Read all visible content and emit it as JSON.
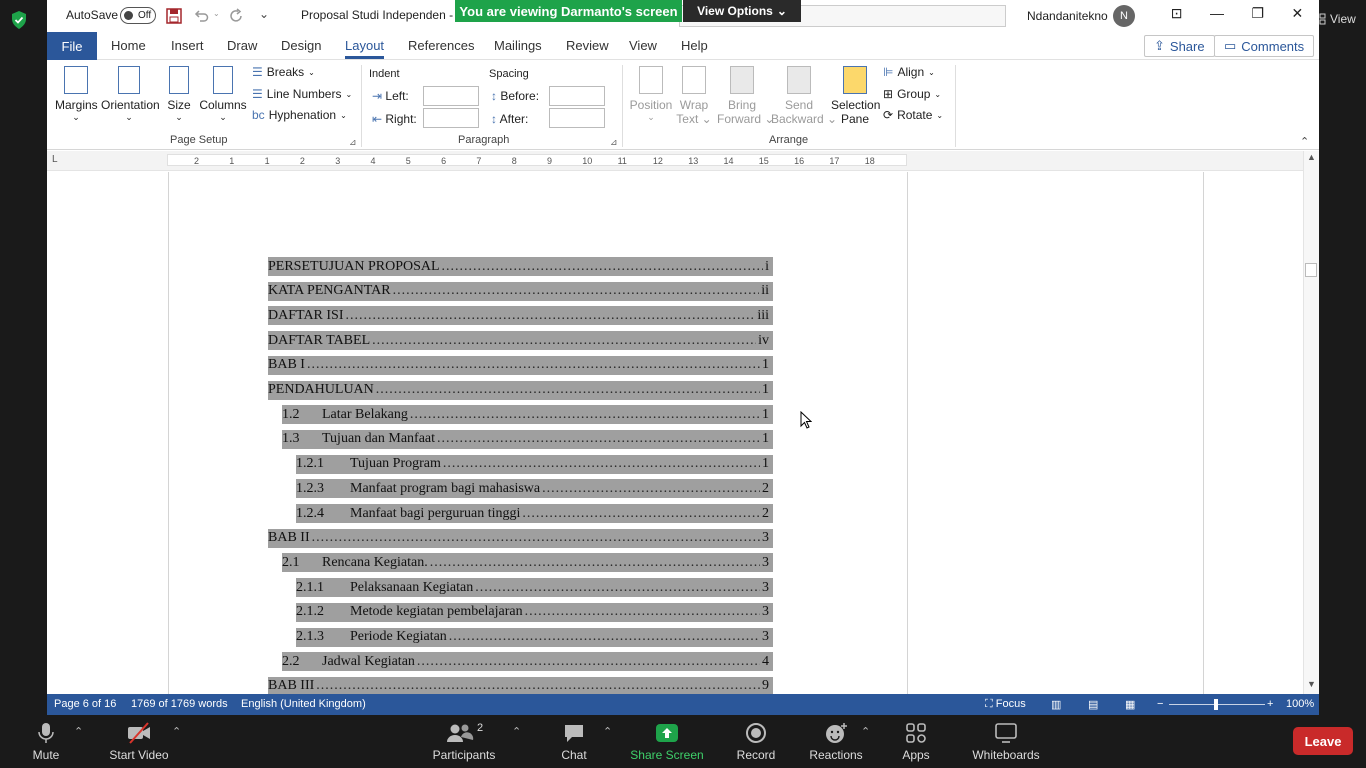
{
  "zoom": {
    "view_label": "View",
    "banner": "You are viewing Darmanto's screen",
    "view_options": "View Options",
    "bottom": {
      "mute": "Mute",
      "start_video": "Start Video",
      "participants": "Participants",
      "participants_count": "2",
      "chat": "Chat",
      "share_screen": "Share Screen",
      "record": "Record",
      "reactions": "Reactions",
      "apps": "Apps",
      "whiteboards": "Whiteboards",
      "leave": "Leave"
    },
    "colors": {
      "share": "#1ea34a",
      "leave": "#c92a2a",
      "bar": "#1a1a1a"
    }
  },
  "word": {
    "titlebar": {
      "autosave": "AutoSave",
      "autosave_state": "Off",
      "doc_title": "Proposal Studi Independen - C",
      "user": "Ndandanitekno",
      "avatar": "N"
    },
    "tabs": [
      "File",
      "Home",
      "Insert",
      "Draw",
      "Design",
      "Layout",
      "References",
      "Mailings",
      "Review",
      "View",
      "Help"
    ],
    "active_tab": "Layout",
    "share": "Share",
    "comments": "Comments",
    "ribbon": {
      "page_setup": {
        "margins": "Margins",
        "orientation": "Orientation",
        "size": "Size",
        "columns": "Columns",
        "breaks": "Breaks",
        "line_numbers": "Line Numbers",
        "hyphenation": "Hyphenation",
        "group": "Page Setup"
      },
      "paragraph": {
        "indent": "Indent",
        "spacing": "Spacing",
        "left": "Left:",
        "right": "Right:",
        "before": "Before:",
        "after": "After:",
        "group": "Paragraph"
      },
      "arrange": {
        "position": "Position",
        "wrap": "Wrap",
        "wrap2": "Text",
        "bring": "Bring",
        "bring2": "Forward",
        "send": "Send",
        "send2": "Backward",
        "selection": "Selection",
        "selection2": "Pane",
        "align": "Align",
        "group_btn": "Group",
        "rotate": "Rotate",
        "group": "Arrange"
      }
    },
    "ruler_numbers": [
      "2",
      "1",
      "1",
      "2",
      "3",
      "4",
      "5",
      "6",
      "7",
      "8",
      "9",
      "10",
      "11",
      "12",
      "13",
      "14",
      "15",
      "16",
      "17",
      "18"
    ],
    "toc": [
      {
        "num": "",
        "title": "PERSETUJUAN PROPOSAL",
        "page": "i",
        "level": 0
      },
      {
        "num": "",
        "title": "KATA PENGANTAR",
        "page": "ii",
        "level": 0
      },
      {
        "num": "",
        "title": "DAFTAR ISI",
        "page": "iii",
        "level": 0
      },
      {
        "num": "",
        "title": "DAFTAR TABEL",
        "page": "iv",
        "level": 0
      },
      {
        "num": "",
        "title": "BAB I",
        "page": "1",
        "level": 0
      },
      {
        "num": "",
        "title": "PENDAHULUAN",
        "page": "1",
        "level": 0
      },
      {
        "num": "1.2",
        "title": "Latar Belakang",
        "page": "1",
        "level": 1
      },
      {
        "num": "1.3",
        "title": "Tujuan dan Manfaat",
        "page": "1",
        "level": 1
      },
      {
        "num": "1.2.1",
        "title": "Tujuan Program",
        "page": "1",
        "level": 2
      },
      {
        "num": "1.2.3",
        "title": "Manfaat program bagi mahasiswa",
        "page": "2",
        "level": 2
      },
      {
        "num": "1.2.4",
        "title": "Manfaat bagi perguruan tinggi",
        "page": "2",
        "level": 2
      },
      {
        "num": "",
        "title": "BAB II",
        "page": "3",
        "level": 0
      },
      {
        "num": "2.1",
        "title": "Rencana Kegiatan.",
        "page": "3",
        "level": 1
      },
      {
        "num": "2.1.1",
        "title": "Pelaksanaan Kegiatan",
        "page": "3",
        "level": 2
      },
      {
        "num": "2.1.2",
        "title": "Metode kegiatan pembelajaran",
        "page": "3",
        "level": 2
      },
      {
        "num": "2.1.3",
        "title": "Periode Kegiatan",
        "page": "3",
        "level": 2
      },
      {
        "num": "2.2",
        "title": "Jadwal Kegiatan",
        "page": "4",
        "level": 1
      },
      {
        "num": "",
        "title": "BAB III",
        "page": "9",
        "level": 0
      }
    ],
    "status": {
      "page": "Page 6 of 16",
      "words": "1769 of 1769 words",
      "language": "English (United Kingdom)",
      "focus": "Focus",
      "zoom": "100%"
    },
    "colors": {
      "accent": "#2b579a",
      "selection": "#9f9f9f"
    }
  }
}
